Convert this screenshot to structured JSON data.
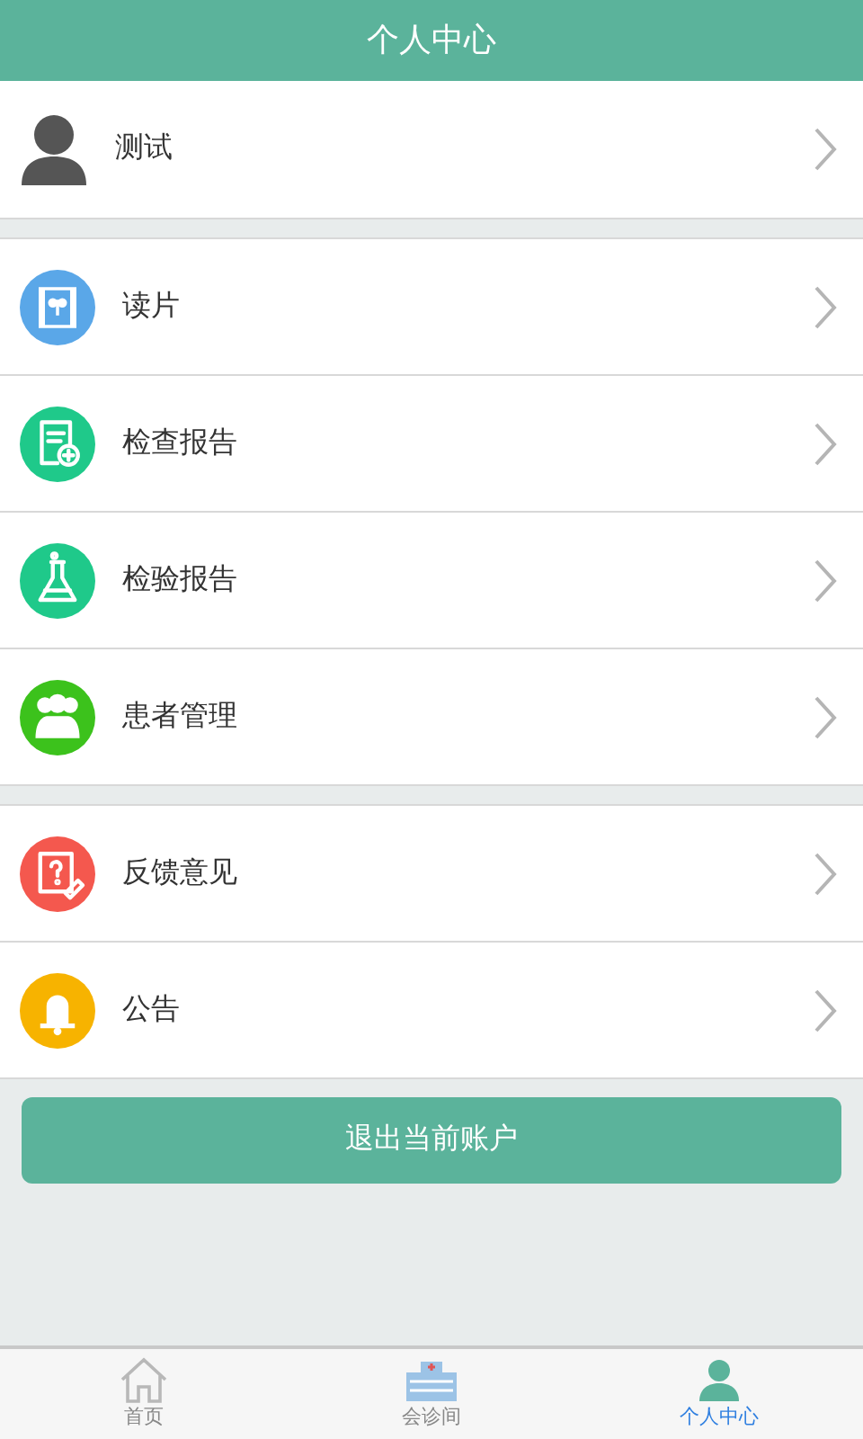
{
  "header": {
    "title": "个人中心"
  },
  "profile": {
    "name": "测试"
  },
  "groups": [
    [
      {
        "label": "读片",
        "kind": "film",
        "color": "#5aa7e8"
      },
      {
        "label": "检查报告",
        "kind": "report",
        "color": "#1fc98a"
      },
      {
        "label": "检验报告",
        "kind": "flask",
        "color": "#1fc98a"
      },
      {
        "label": "患者管理",
        "kind": "people",
        "color": "#3cc21c"
      }
    ],
    [
      {
        "label": "反馈意见",
        "kind": "feedback",
        "color": "#f4584e"
      },
      {
        "label": "公告",
        "kind": "bell",
        "color": "#f7b300"
      }
    ]
  ],
  "logout_button": "退出当前账户",
  "tabs": [
    {
      "label": "首页",
      "kind": "home",
      "selected": false
    },
    {
      "label": "会诊间",
      "kind": "hospital",
      "selected": false
    },
    {
      "label": "个人中心",
      "kind": "person",
      "selected": true
    }
  ]
}
